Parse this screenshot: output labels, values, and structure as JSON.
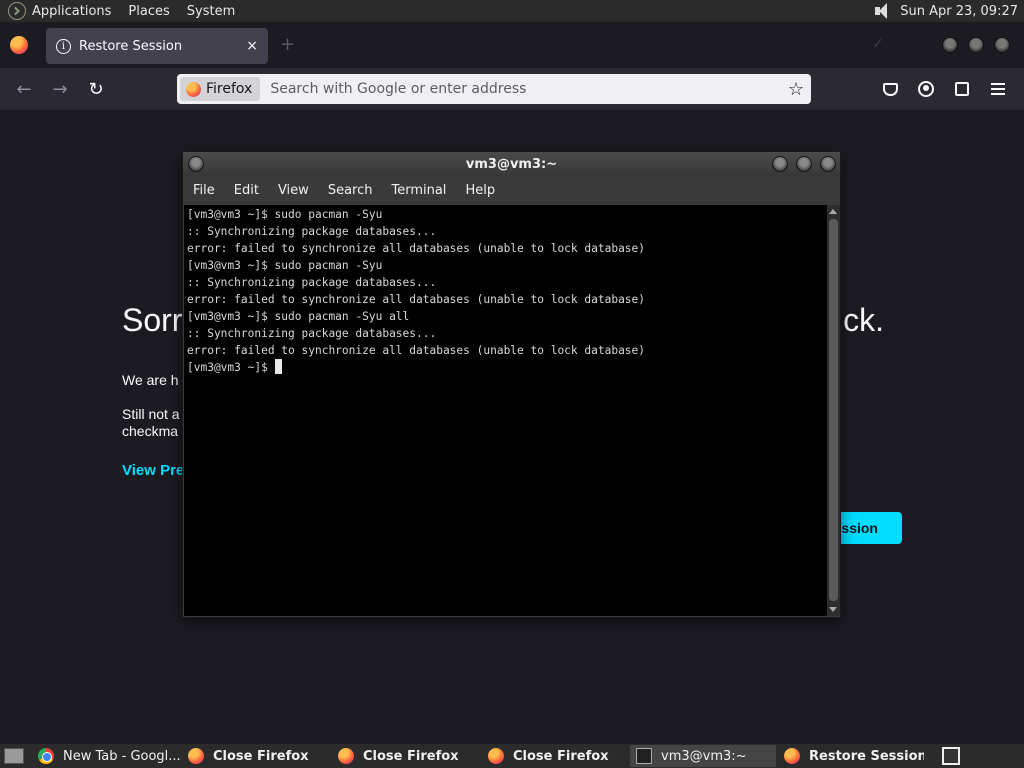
{
  "top_panel": {
    "menus": [
      "Applications",
      "Places",
      "System"
    ],
    "clock": "Sun Apr 23, 09:27"
  },
  "browser": {
    "tab": {
      "title": "Restore Session",
      "close_glyph": "×"
    },
    "new_tab_glyph": "+",
    "urlbar": {
      "identity_label": "Firefox",
      "placeholder": "Search with Google or enter address"
    },
    "nav": {
      "back_glyph": "←",
      "forward_glyph": "→",
      "reload_glyph": "↻",
      "star_glyph": "☆"
    }
  },
  "page": {
    "heading_left": "Sorr",
    "heading_right": "ck.",
    "p1": "We are h",
    "p2_line1": "Still not a",
    "p2_line2": "checkma",
    "view_previous": "View Pre",
    "restore_button": "ssion"
  },
  "terminal": {
    "title": "vm3@vm3:~",
    "menus": [
      "File",
      "Edit",
      "View",
      "Search",
      "Terminal",
      "Help"
    ],
    "lines": [
      "[vm3@vm3 ~]$ sudo pacman -Syu",
      ":: Synchronizing package databases...",
      "error: failed to synchronize all databases (unable to lock database)",
      "[vm3@vm3 ~]$ sudo pacman -Syu",
      ":: Synchronizing package databases...",
      "error: failed to synchronize all databases (unable to lock database)",
      "[vm3@vm3 ~]$ sudo pacman -Syu all",
      ":: Synchronizing package databases...",
      "error: failed to synchronize all databases (unable to lock database)"
    ],
    "prompt": "[vm3@vm3 ~]$ "
  },
  "taskbar": {
    "tasks": [
      {
        "label": "New Tab - Googl...",
        "icon": "chrome-icon",
        "bold": false,
        "active": false
      },
      {
        "label": "Close Firefox",
        "icon": "firefox-icon",
        "bold": true,
        "active": false
      },
      {
        "label": "Close Firefox",
        "icon": "firefox-icon",
        "bold": true,
        "active": false
      },
      {
        "label": "Close Firefox",
        "icon": "firefox-icon",
        "bold": true,
        "active": false
      },
      {
        "label": "vm3@vm3:~",
        "icon": "terminal-icon",
        "bold": false,
        "active": true
      },
      {
        "label": "Restore Session...",
        "icon": "firefox-icon",
        "bold": true,
        "active": false
      }
    ]
  },
  "colors": {
    "accent": "#00ddff",
    "terminal_bg": "#000000",
    "terminal_fg": "#d8d8d8",
    "content_bg": "#1c1b22"
  }
}
